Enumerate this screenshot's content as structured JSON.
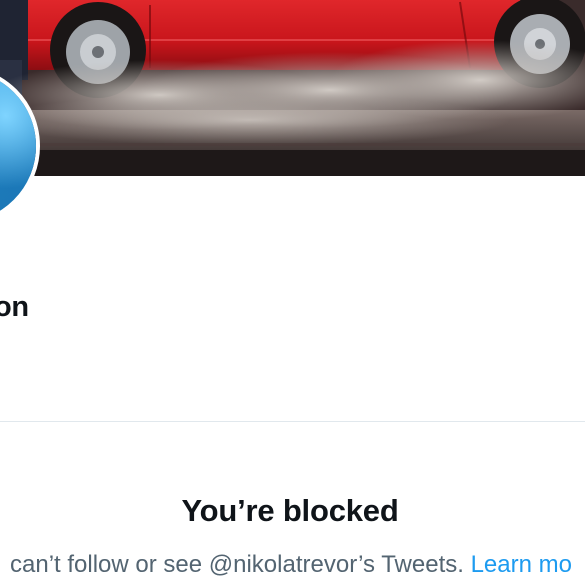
{
  "banner": {
    "description_icon": "banner-image",
    "colors": {
      "truck_red": "#c8151b",
      "smoke": "#b9b2ac",
      "ground": "#2b2222"
    }
  },
  "profile": {
    "avatar_icon": "avatar-image",
    "display_name_visible": "on"
  },
  "blocked": {
    "title": "You’re blocked",
    "message_prefix": "can’t follow or see @nikolatrevor’s Tweets. ",
    "learn_more_label": "Learn mo"
  },
  "colors": {
    "text_primary": "#0f1419",
    "text_secondary": "#536471",
    "link": "#1d9bf0",
    "divider": "#e1e8ed"
  }
}
